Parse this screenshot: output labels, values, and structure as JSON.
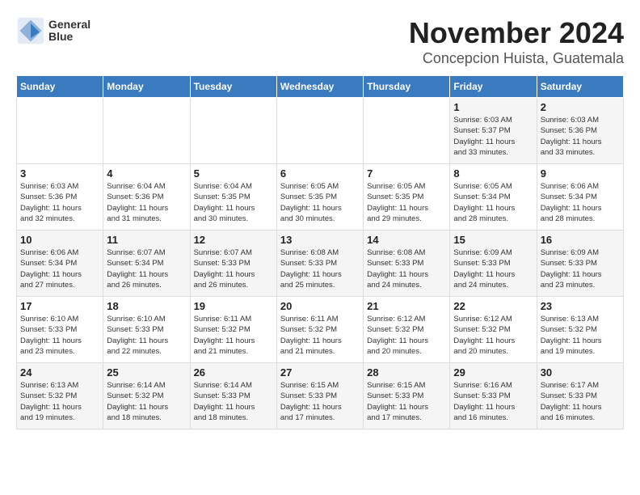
{
  "logo": {
    "line1": "General",
    "line2": "Blue"
  },
  "title": "November 2024",
  "subtitle": "Concepcion Huista, Guatemala",
  "weekdays": [
    "Sunday",
    "Monday",
    "Tuesday",
    "Wednesday",
    "Thursday",
    "Friday",
    "Saturday"
  ],
  "weeks": [
    [
      {
        "day": "",
        "info": ""
      },
      {
        "day": "",
        "info": ""
      },
      {
        "day": "",
        "info": ""
      },
      {
        "day": "",
        "info": ""
      },
      {
        "day": "",
        "info": ""
      },
      {
        "day": "1",
        "info": "Sunrise: 6:03 AM\nSunset: 5:37 PM\nDaylight: 11 hours\nand 33 minutes."
      },
      {
        "day": "2",
        "info": "Sunrise: 6:03 AM\nSunset: 5:36 PM\nDaylight: 11 hours\nand 33 minutes."
      }
    ],
    [
      {
        "day": "3",
        "info": "Sunrise: 6:03 AM\nSunset: 5:36 PM\nDaylight: 11 hours\nand 32 minutes."
      },
      {
        "day": "4",
        "info": "Sunrise: 6:04 AM\nSunset: 5:36 PM\nDaylight: 11 hours\nand 31 minutes."
      },
      {
        "day": "5",
        "info": "Sunrise: 6:04 AM\nSunset: 5:35 PM\nDaylight: 11 hours\nand 30 minutes."
      },
      {
        "day": "6",
        "info": "Sunrise: 6:05 AM\nSunset: 5:35 PM\nDaylight: 11 hours\nand 30 minutes."
      },
      {
        "day": "7",
        "info": "Sunrise: 6:05 AM\nSunset: 5:35 PM\nDaylight: 11 hours\nand 29 minutes."
      },
      {
        "day": "8",
        "info": "Sunrise: 6:05 AM\nSunset: 5:34 PM\nDaylight: 11 hours\nand 28 minutes."
      },
      {
        "day": "9",
        "info": "Sunrise: 6:06 AM\nSunset: 5:34 PM\nDaylight: 11 hours\nand 28 minutes."
      }
    ],
    [
      {
        "day": "10",
        "info": "Sunrise: 6:06 AM\nSunset: 5:34 PM\nDaylight: 11 hours\nand 27 minutes."
      },
      {
        "day": "11",
        "info": "Sunrise: 6:07 AM\nSunset: 5:34 PM\nDaylight: 11 hours\nand 26 minutes."
      },
      {
        "day": "12",
        "info": "Sunrise: 6:07 AM\nSunset: 5:33 PM\nDaylight: 11 hours\nand 26 minutes."
      },
      {
        "day": "13",
        "info": "Sunrise: 6:08 AM\nSunset: 5:33 PM\nDaylight: 11 hours\nand 25 minutes."
      },
      {
        "day": "14",
        "info": "Sunrise: 6:08 AM\nSunset: 5:33 PM\nDaylight: 11 hours\nand 24 minutes."
      },
      {
        "day": "15",
        "info": "Sunrise: 6:09 AM\nSunset: 5:33 PM\nDaylight: 11 hours\nand 24 minutes."
      },
      {
        "day": "16",
        "info": "Sunrise: 6:09 AM\nSunset: 5:33 PM\nDaylight: 11 hours\nand 23 minutes."
      }
    ],
    [
      {
        "day": "17",
        "info": "Sunrise: 6:10 AM\nSunset: 5:33 PM\nDaylight: 11 hours\nand 23 minutes."
      },
      {
        "day": "18",
        "info": "Sunrise: 6:10 AM\nSunset: 5:33 PM\nDaylight: 11 hours\nand 22 minutes."
      },
      {
        "day": "19",
        "info": "Sunrise: 6:11 AM\nSunset: 5:32 PM\nDaylight: 11 hours\nand 21 minutes."
      },
      {
        "day": "20",
        "info": "Sunrise: 6:11 AM\nSunset: 5:32 PM\nDaylight: 11 hours\nand 21 minutes."
      },
      {
        "day": "21",
        "info": "Sunrise: 6:12 AM\nSunset: 5:32 PM\nDaylight: 11 hours\nand 20 minutes."
      },
      {
        "day": "22",
        "info": "Sunrise: 6:12 AM\nSunset: 5:32 PM\nDaylight: 11 hours\nand 20 minutes."
      },
      {
        "day": "23",
        "info": "Sunrise: 6:13 AM\nSunset: 5:32 PM\nDaylight: 11 hours\nand 19 minutes."
      }
    ],
    [
      {
        "day": "24",
        "info": "Sunrise: 6:13 AM\nSunset: 5:32 PM\nDaylight: 11 hours\nand 19 minutes."
      },
      {
        "day": "25",
        "info": "Sunrise: 6:14 AM\nSunset: 5:32 PM\nDaylight: 11 hours\nand 18 minutes."
      },
      {
        "day": "26",
        "info": "Sunrise: 6:14 AM\nSunset: 5:33 PM\nDaylight: 11 hours\nand 18 minutes."
      },
      {
        "day": "27",
        "info": "Sunrise: 6:15 AM\nSunset: 5:33 PM\nDaylight: 11 hours\nand 17 minutes."
      },
      {
        "day": "28",
        "info": "Sunrise: 6:15 AM\nSunset: 5:33 PM\nDaylight: 11 hours\nand 17 minutes."
      },
      {
        "day": "29",
        "info": "Sunrise: 6:16 AM\nSunset: 5:33 PM\nDaylight: 11 hours\nand 16 minutes."
      },
      {
        "day": "30",
        "info": "Sunrise: 6:17 AM\nSunset: 5:33 PM\nDaylight: 11 hours\nand 16 minutes."
      }
    ]
  ]
}
